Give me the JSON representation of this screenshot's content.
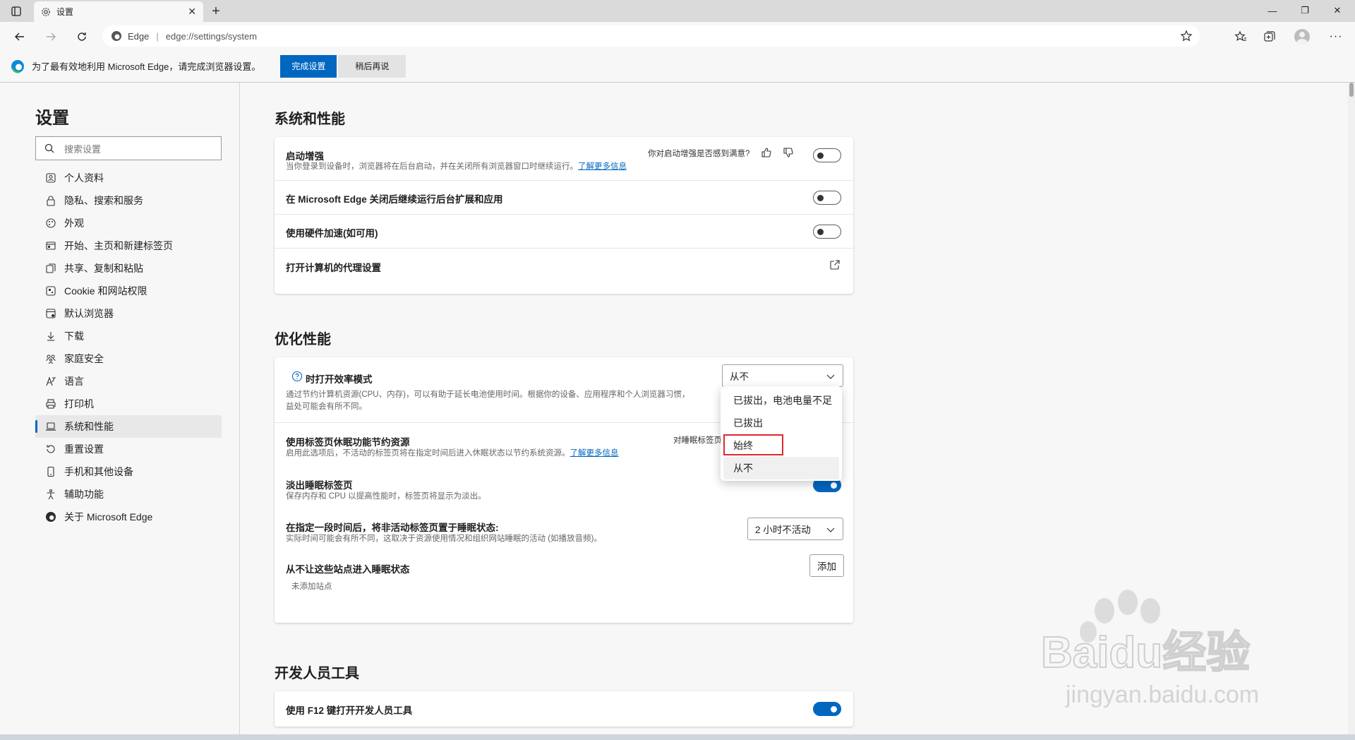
{
  "tab": {
    "title": "设置",
    "close": "✕",
    "new_tab": "+"
  },
  "window": {
    "minimize": "—",
    "restore": "❐",
    "close": "✕"
  },
  "address": {
    "site_name": "Edge",
    "separator": "|",
    "url": "edge://settings/system"
  },
  "infobar": {
    "message": "为了最有效地利用 Microsoft Edge，请完成浏览器设置。",
    "primary_label": "完成设置",
    "secondary_label": "稍后再说"
  },
  "sidebar": {
    "title": "设置",
    "search_placeholder": "搜索设置",
    "items": [
      {
        "label": "个人资料",
        "icon": "profile-icon"
      },
      {
        "label": "隐私、搜索和服务",
        "icon": "lock-icon"
      },
      {
        "label": "外观",
        "icon": "appearance-icon"
      },
      {
        "label": "开始、主页和新建标签页",
        "icon": "home-icon"
      },
      {
        "label": "共享、复制和粘贴",
        "icon": "share-icon"
      },
      {
        "label": "Cookie 和网站权限",
        "icon": "cookie-icon"
      },
      {
        "label": "默认浏览器",
        "icon": "browser-icon"
      },
      {
        "label": "下载",
        "icon": "download-icon"
      },
      {
        "label": "家庭安全",
        "icon": "family-icon"
      },
      {
        "label": "语言",
        "icon": "language-icon"
      },
      {
        "label": "打印机",
        "icon": "printer-icon"
      },
      {
        "label": "系统和性能",
        "icon": "laptop-icon",
        "active": true
      },
      {
        "label": "重置设置",
        "icon": "reset-icon"
      },
      {
        "label": "手机和其他设备",
        "icon": "phone-icon"
      },
      {
        "label": "辅助功能",
        "icon": "accessibility-icon"
      },
      {
        "label": "关于 Microsoft Edge",
        "icon": "edge-icon"
      }
    ]
  },
  "system": {
    "title": "系统和性能",
    "startup_boost": {
      "title": "启动增强",
      "desc": "当你登录到设备时，浏览器将在后台启动，并在关闭所有浏览器窗口时继续运行。",
      "link": "了解更多信息",
      "feedback": "你对启动增强是否感到满意?",
      "enabled": false
    },
    "background_ext": {
      "title": "在 Microsoft Edge 关闭后继续运行后台扩展和应用",
      "enabled": false
    },
    "hardware_accel": {
      "title": "使用硬件加速(如可用)",
      "enabled": false
    },
    "proxy": {
      "title": "打开计算机的代理设置"
    }
  },
  "optimize": {
    "title": "优化性能",
    "efficiency": {
      "title": "时打开效率模式",
      "desc1": "通过节约计算机资源(CPU、内存)，可以有助于延长电池使用时间。根据你的设备、应用程序和个人浏览器习惯，",
      "desc2": "益处可能会有所不同。",
      "selected": "从不",
      "options": [
        "已拔出，电池电量不足",
        "已拔出",
        "始终",
        "从不"
      ]
    },
    "sleeping_tabs": {
      "title": "使用标签页休眠功能节约资源",
      "desc": "启用此选项后，不活动的标签页将在指定时间后进入休眠状态以节约系统资源。",
      "link": "了解更多信息",
      "feedback": "对睡眠标签页"
    },
    "fade_tabs": {
      "title": "淡出睡眠标签页",
      "desc": "保存内存和 CPU 以提高性能时，标签页将显示为淡出。",
      "enabled": true
    },
    "sleep_after": {
      "title": "在指定一段时间后，将非活动标签页置于睡眠状态:",
      "desc": "实际时间可能会有所不同，这取决于资源使用情况和组织网站睡眠的活动 (如播放音频)。",
      "selected": "2 小时不活动"
    },
    "never_sleep": {
      "title": "从不让这些站点进入睡眠状态",
      "add_label": "添加",
      "empty": "未添加站点"
    }
  },
  "dev": {
    "title": "开发人员工具",
    "f12": {
      "title": "使用 F12 键打开开发人员工具",
      "enabled": true
    }
  },
  "watermark": {
    "brand": "Baidu经验",
    "url": "jingyan.baidu.com"
  }
}
